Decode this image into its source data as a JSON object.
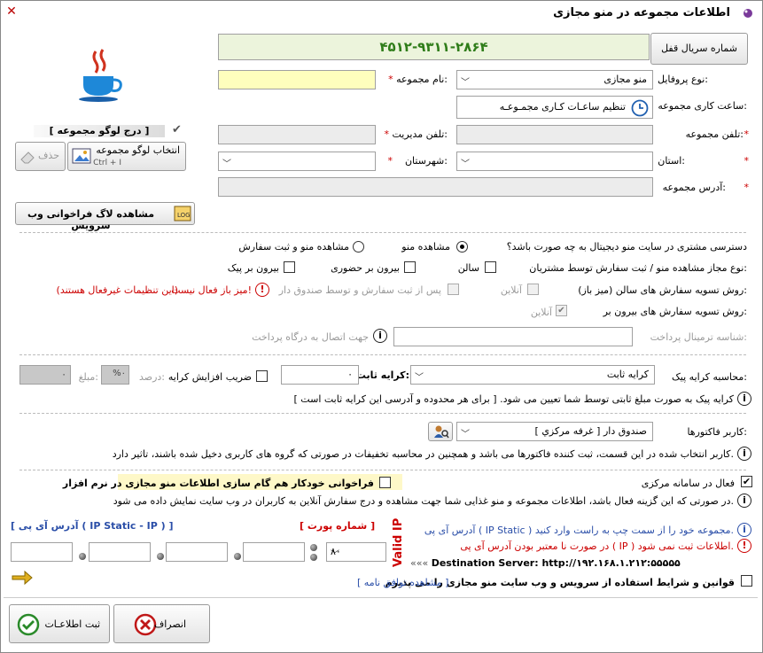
{
  "window": {
    "title": "اطلاعات مجموعه در منو مجازی",
    "close": "✕"
  },
  "serial": {
    "button": "شماره سریال قفل",
    "value": "۴۵۱۲-۹۳۱۱-۲۸۶۴"
  },
  "form": {
    "profile_label": "نوع پروفایل:",
    "profile_value": "منو مجازی",
    "name_label": "نام مجموعه:",
    "hours_label": "ساعت کاری مجموعه:",
    "hours_button": "تنظیم ساعـات کـاری مجمـوعـه",
    "phone_label": "تلفن مجموعه:",
    "manager_phone_label": "تلفن مدیریت:",
    "province_label": "استان:",
    "city_label": "شهرستان:",
    "address_label": "آدرس مجموعه:",
    "required": "*"
  },
  "logo": {
    "insert_label": "[ درج لوگو مجموعه ]",
    "select_button": "انتخاب لوگو مجموعه",
    "shortcut": "Ctrl + I",
    "delete_button": "حذف",
    "check": "✔"
  },
  "log_button": "مشاهده لاگ فراخوانی وب سرویس",
  "access": {
    "question": "دسترسی مشتری در سایت منو دیجیتال به چه صورت باشد؟",
    "opt_view": "مشاهده منو",
    "opt_view_order": "مشاهده منو و ثبت سفارش"
  },
  "order_types": {
    "label": "نوع مجاز مشاهده منو / ثبت سفارش توسط مشتریان:",
    "salon": "سالن",
    "takeout": "بیرون بر حضوری",
    "delivery": "بیرون بر پیک"
  },
  "salon_settle": {
    "label": "روش تسویه سفارش های سالن (میز باز):",
    "online": "آنلاین",
    "after": "پس از ثبت سفارش و توسط صندوق دار",
    "warning": "میز باز فعال نیست!",
    "warning_note": "(این تنظیمات غیرفعال هستند)"
  },
  "out_settle": {
    "label": "روش تسویه سفارش های بیرون بر:",
    "online": "آنلاین"
  },
  "terminal": {
    "label": "شناسه ترمینال پرداخت:",
    "note": "جهت اتصال به درگاه پرداخت"
  },
  "delivery_fee": {
    "label": "محاسبه کرایه پیک:",
    "type_value": "کرایه ثابت",
    "fixed_label": "کرایه ثابت:",
    "fixed_value": "۰",
    "multiplier_label": "ضریب افزایش کرایه",
    "percent_label": "درصد:",
    "percent_value": "%۰",
    "amount_label": "مبلغ:",
    "amount_value": "۰",
    "note": "کرایه پیک به صورت مبلغ ثابتی توسط شما تعیین می شود. [ برای هر محدوده و آدرسی این کرایه ثابت است ]"
  },
  "invoice_user": {
    "label": "کاربر فاکتورها:",
    "value": "صندوق دار [ غرفه  مرکزي ]",
    "note": "کاربر انتخاب شده در این قسمت، ثبت کننده فاکتورها می باشد و همچنین در محاسبه تخفیفات در صورتی که گروه های کاربری دخیل شده باشند، تاثیر دارد."
  },
  "central": {
    "active_label": "فعال در سامانه مرکزی",
    "sync_label": "فراخوانی خودکار هم گام سازی اطلاعات منو مجازی در نرم افزار",
    "note": "در صورتی که این گزینه فعال باشد، اطلاعات مجموعه و منو غذایی شما جهت مشاهده و درج سفارش آنلاین به کاربران در وب سایت نمایش داده می شود."
  },
  "ip": {
    "title_left": "[ آدرس آی پی ( IP Static - IP ) ]",
    "port_title": "[ شماره پورت ]",
    "port_value": "۸۰",
    "valid": "Valid IP",
    "hint": "آدرس آی پی ( IP Static ) مجموعه خود را از سمت چپ به راست وارد کنید.",
    "error": "در صورت نا معتبر بودن آدرس آی پی ( IP ) اطلاعات ثبت نمی شود.",
    "server_label": "Destination Server: http://۱۹۲.۱۶۸.۱.۲۱۲:۵۵۵۵۵",
    "server_prefix": "«««"
  },
  "terms": {
    "label": "قوانین و شرایط استفاده از سرویس و وب سایت منو مجازی را می پذیرم",
    "link": "[ مشاهده توافق نامه ]"
  },
  "buttons": {
    "save": "ثبت اطلاعـات",
    "cancel": "انصراف"
  }
}
